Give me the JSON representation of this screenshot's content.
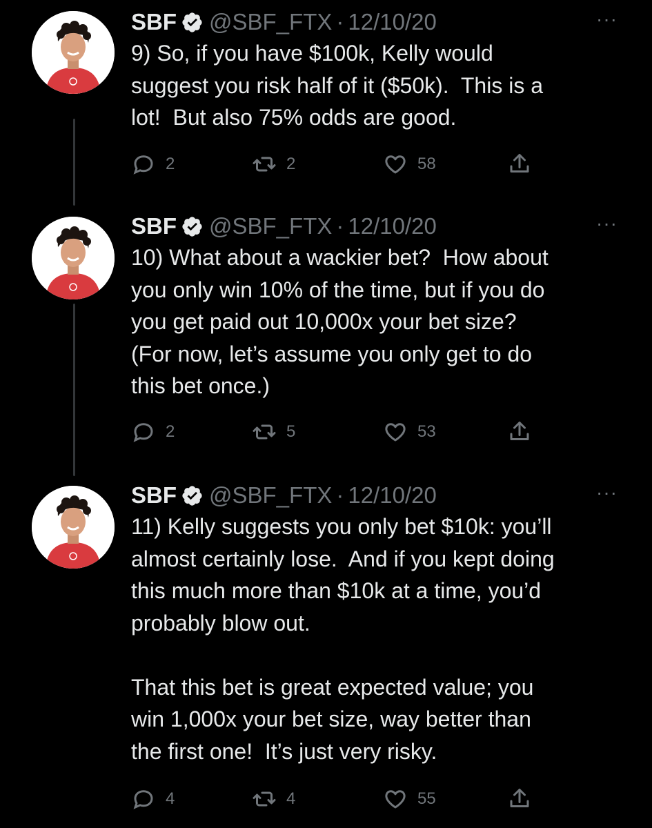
{
  "colors": {
    "background": "#000000",
    "text": "#e7e9ea",
    "muted": "#71767b",
    "thread_line": "#333639",
    "shirt": "#d93b3f"
  },
  "icons": {
    "verified": "verified-badge-icon",
    "more": "more-options-icon",
    "reply": "reply-icon",
    "retweet": "retweet-icon",
    "like": "like-icon",
    "share": "share-icon"
  },
  "tweets": [
    {
      "name": "SBF",
      "handle": "@SBF_FTX",
      "separator": "·",
      "date": "12/10/20",
      "more": "···",
      "text": "9) So, if you have $100k, Kelly would\nsuggest you risk half of it ($50k).  This is a\nlot!  But also 75% odds are good.",
      "replies": "2",
      "retweets": "2",
      "likes": "58"
    },
    {
      "name": "SBF",
      "handle": "@SBF_FTX",
      "separator": "·",
      "date": "12/10/20",
      "more": "···",
      "text": "10) What about a wackier bet?  How about\nyou only win 10% of the time, but if you do\nyou get paid out 10,000x your bet size?\n(For now, let’s assume you only get to do\nthis bet once.)",
      "replies": "2",
      "retweets": "5",
      "likes": "53"
    },
    {
      "name": "SBF",
      "handle": "@SBF_FTX",
      "separator": "·",
      "date": "12/10/20",
      "more": "···",
      "text": "11) Kelly suggests you only bet $10k: you’ll\nalmost certainly lose.  And if you kept doing\nthis much more than $10k at a time, you’d\nprobably blow out.\n\nThat this bet is great expected value; you\nwin 1,000x your bet size, way better than\nthe first one!  It’s just very risky.",
      "replies": "4",
      "retweets": "4",
      "likes": "55"
    }
  ]
}
